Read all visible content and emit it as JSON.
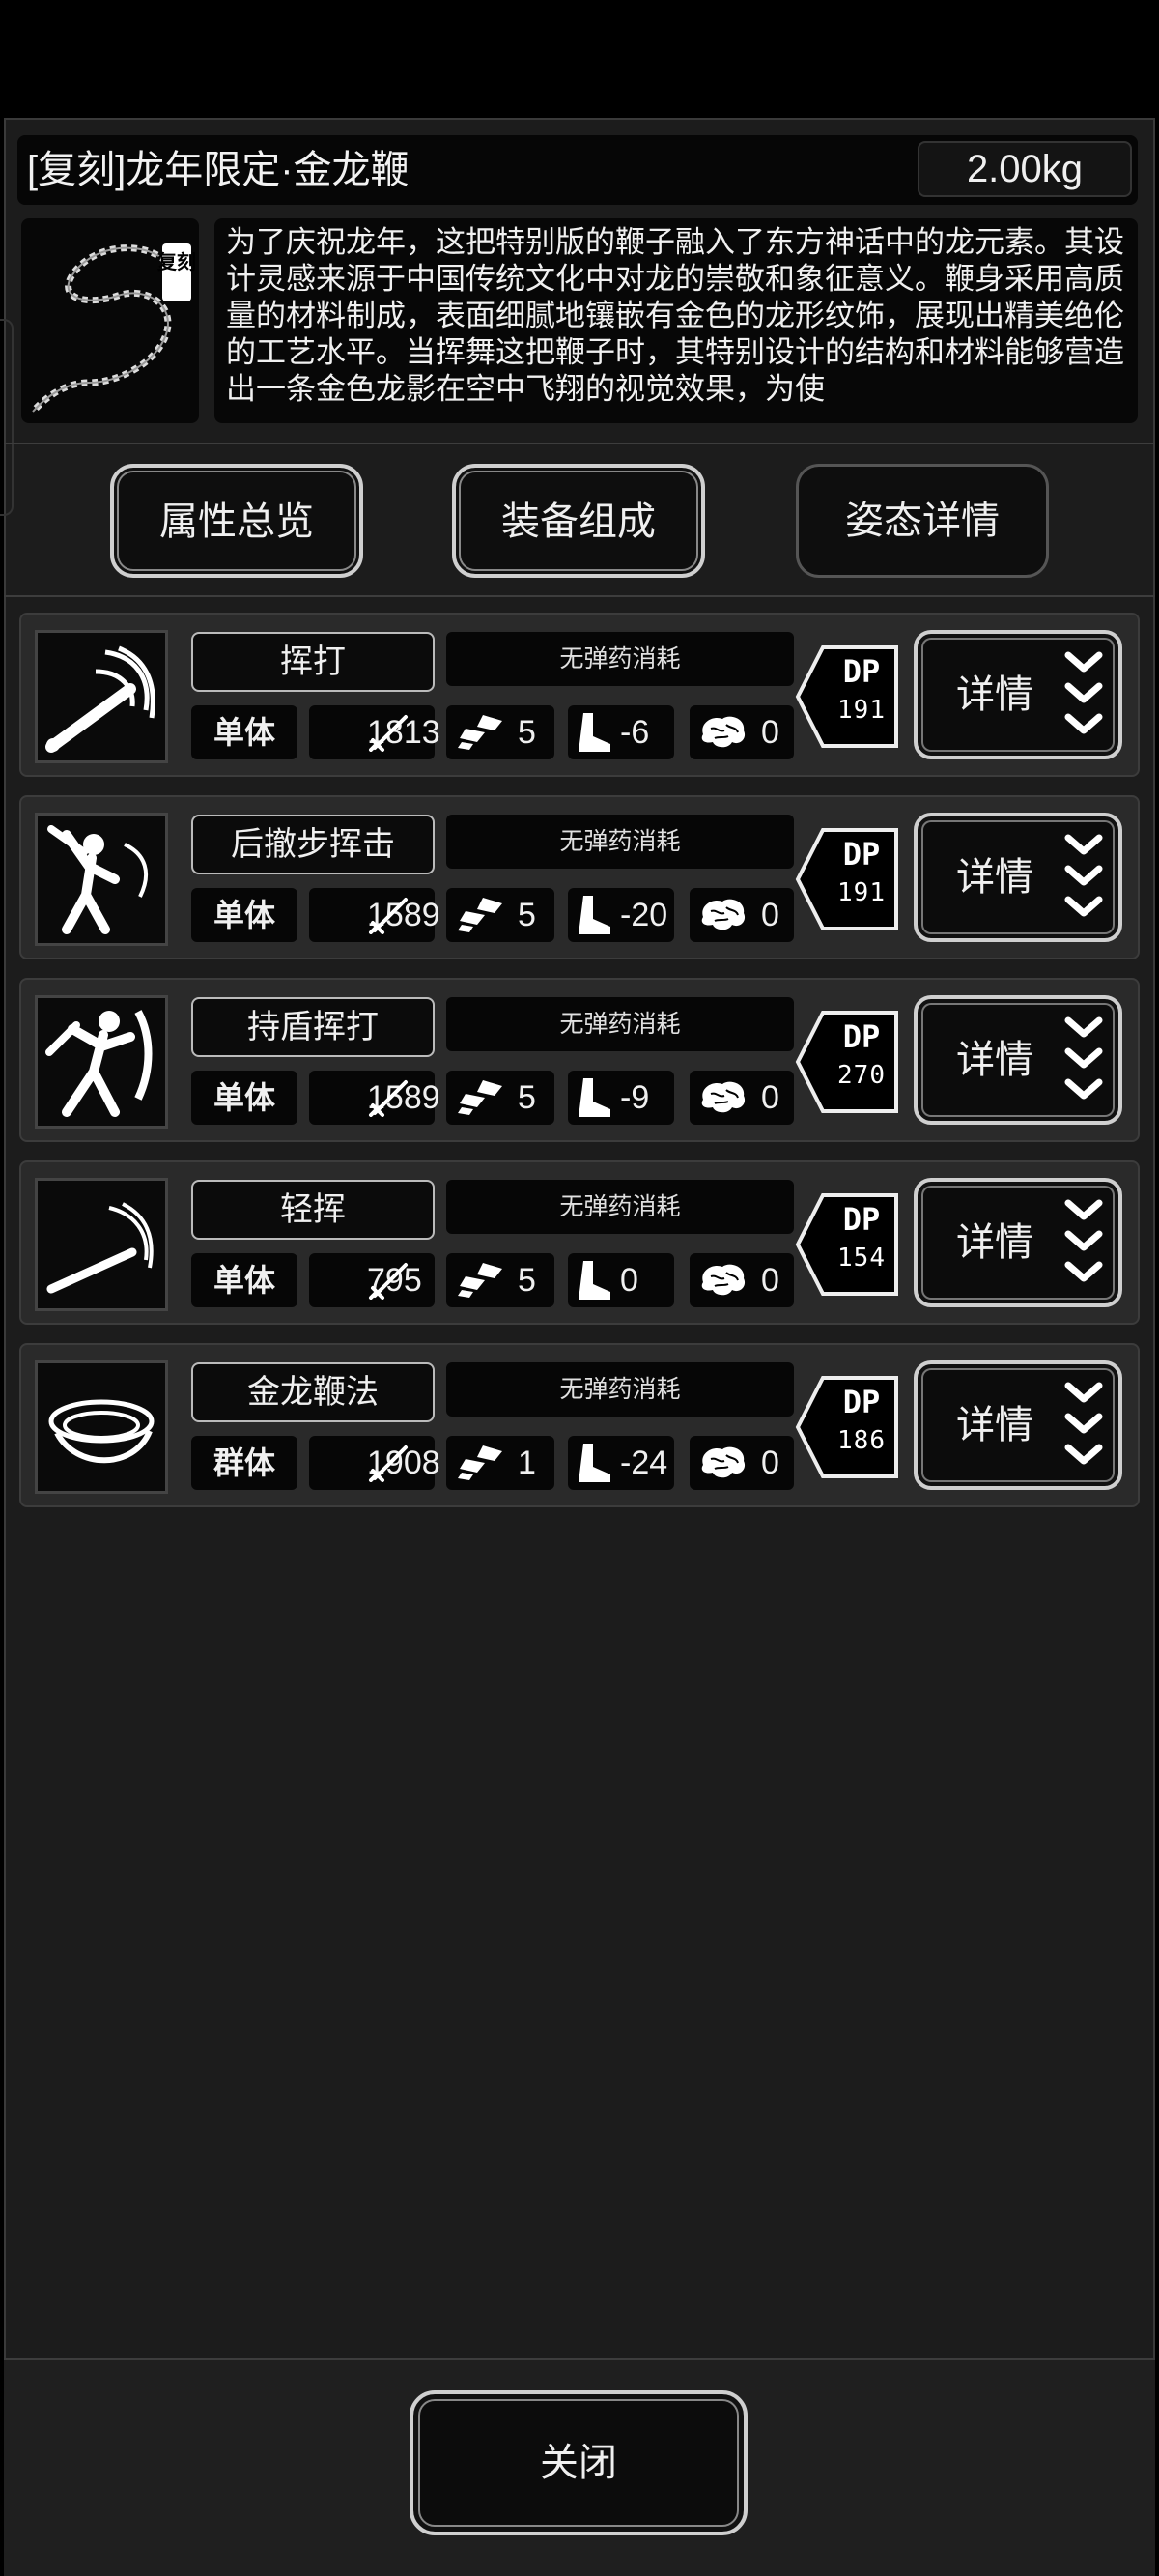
{
  "item": {
    "title": "[复刻]龙年限定·金龙鞭",
    "weight": "2.00kg",
    "badge": "复刻",
    "description": "为了庆祝龙年，这把特别版的鞭子融入了东方神话中的龙元素。其设计灵感来源于中国传统文化中对龙的崇敬和象征意义。鞭身采用高质量的材料制成，表面细腻地镶嵌有金色的龙形纹饰，展现出精美绝伦的工艺水平。当挥舞这把鞭子时，其特别设计的结构和材料能够营造出一条金色龙影在空中飞翔的视觉效果，为使"
  },
  "tabs": [
    {
      "label": "属性总览"
    },
    {
      "label": "装备组成"
    },
    {
      "label": "姿态详情"
    }
  ],
  "skills": [
    {
      "name": "挥打",
      "ammo": "无弹药消耗",
      "target": "单体",
      "attack": "1813",
      "hit": "5",
      "speed": "-6",
      "mental": "0",
      "dp_label": "DP",
      "dp": "191",
      "detail": "详情",
      "icon": "swing-icon"
    },
    {
      "name": "后撤步挥击",
      "ammo": "无弹药消耗",
      "target": "单体",
      "attack": "1589",
      "hit": "5",
      "speed": "-20",
      "mental": "0",
      "dp_label": "DP",
      "dp": "191",
      "detail": "详情",
      "icon": "backstep-swing-icon"
    },
    {
      "name": "持盾挥打",
      "ammo": "无弹药消耗",
      "target": "单体",
      "attack": "1589",
      "hit": "5",
      "speed": "-9",
      "mental": "0",
      "dp_label": "DP",
      "dp": "270",
      "detail": "详情",
      "icon": "shield-swing-icon"
    },
    {
      "name": "轻挥",
      "ammo": "无弹药消耗",
      "target": "单体",
      "attack": "795",
      "hit": "5",
      "speed": "0",
      "mental": "0",
      "dp_label": "DP",
      "dp": "154",
      "detail": "详情",
      "icon": "light-swing-icon"
    },
    {
      "name": "金龙鞭法",
      "ammo": "无弹药消耗",
      "target": "群体",
      "attack": "1908",
      "hit": "1",
      "speed": "-24",
      "mental": "0",
      "dp_label": "DP",
      "dp": "186",
      "detail": "详情",
      "icon": "whirl-icon"
    }
  ],
  "close_label": "关闭"
}
